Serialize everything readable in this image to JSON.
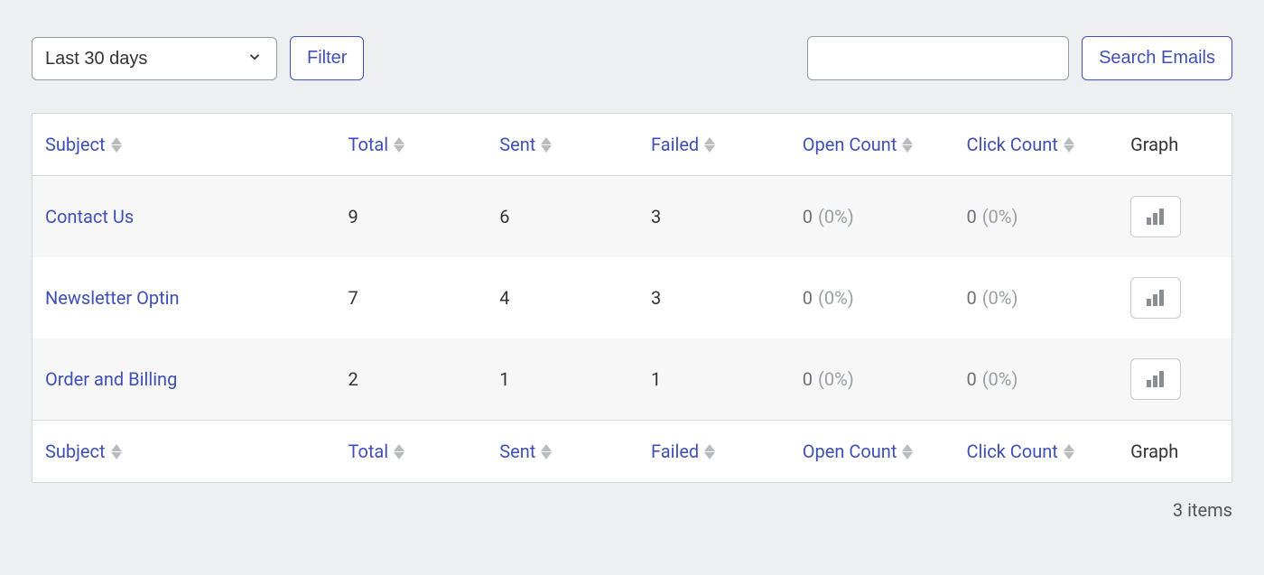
{
  "toolbar": {
    "date_range_selected": "Last 30 days",
    "filter_label": "Filter",
    "search_value": "",
    "search_button_label": "Search Emails"
  },
  "columns": {
    "subject": "Subject",
    "total": "Total",
    "sent": "Sent",
    "failed": "Failed",
    "open_count": "Open Count",
    "click_count": "Click Count",
    "graph": "Graph"
  },
  "rows": [
    {
      "subject": "Contact Us",
      "total": "9",
      "sent": "6",
      "failed": "3",
      "open_count": "0",
      "open_pct": "(0%)",
      "click_count": "0",
      "click_pct": "(0%)"
    },
    {
      "subject": "Newsletter Optin",
      "total": "7",
      "sent": "4",
      "failed": "3",
      "open_count": "0",
      "open_pct": "(0%)",
      "click_count": "0",
      "click_pct": "(0%)"
    },
    {
      "subject": "Order and Billing",
      "total": "2",
      "sent": "1",
      "failed": "1",
      "open_count": "0",
      "open_pct": "(0%)",
      "click_count": "0",
      "click_pct": "(0%)"
    }
  ],
  "footer": {
    "items_text": "3 items"
  }
}
